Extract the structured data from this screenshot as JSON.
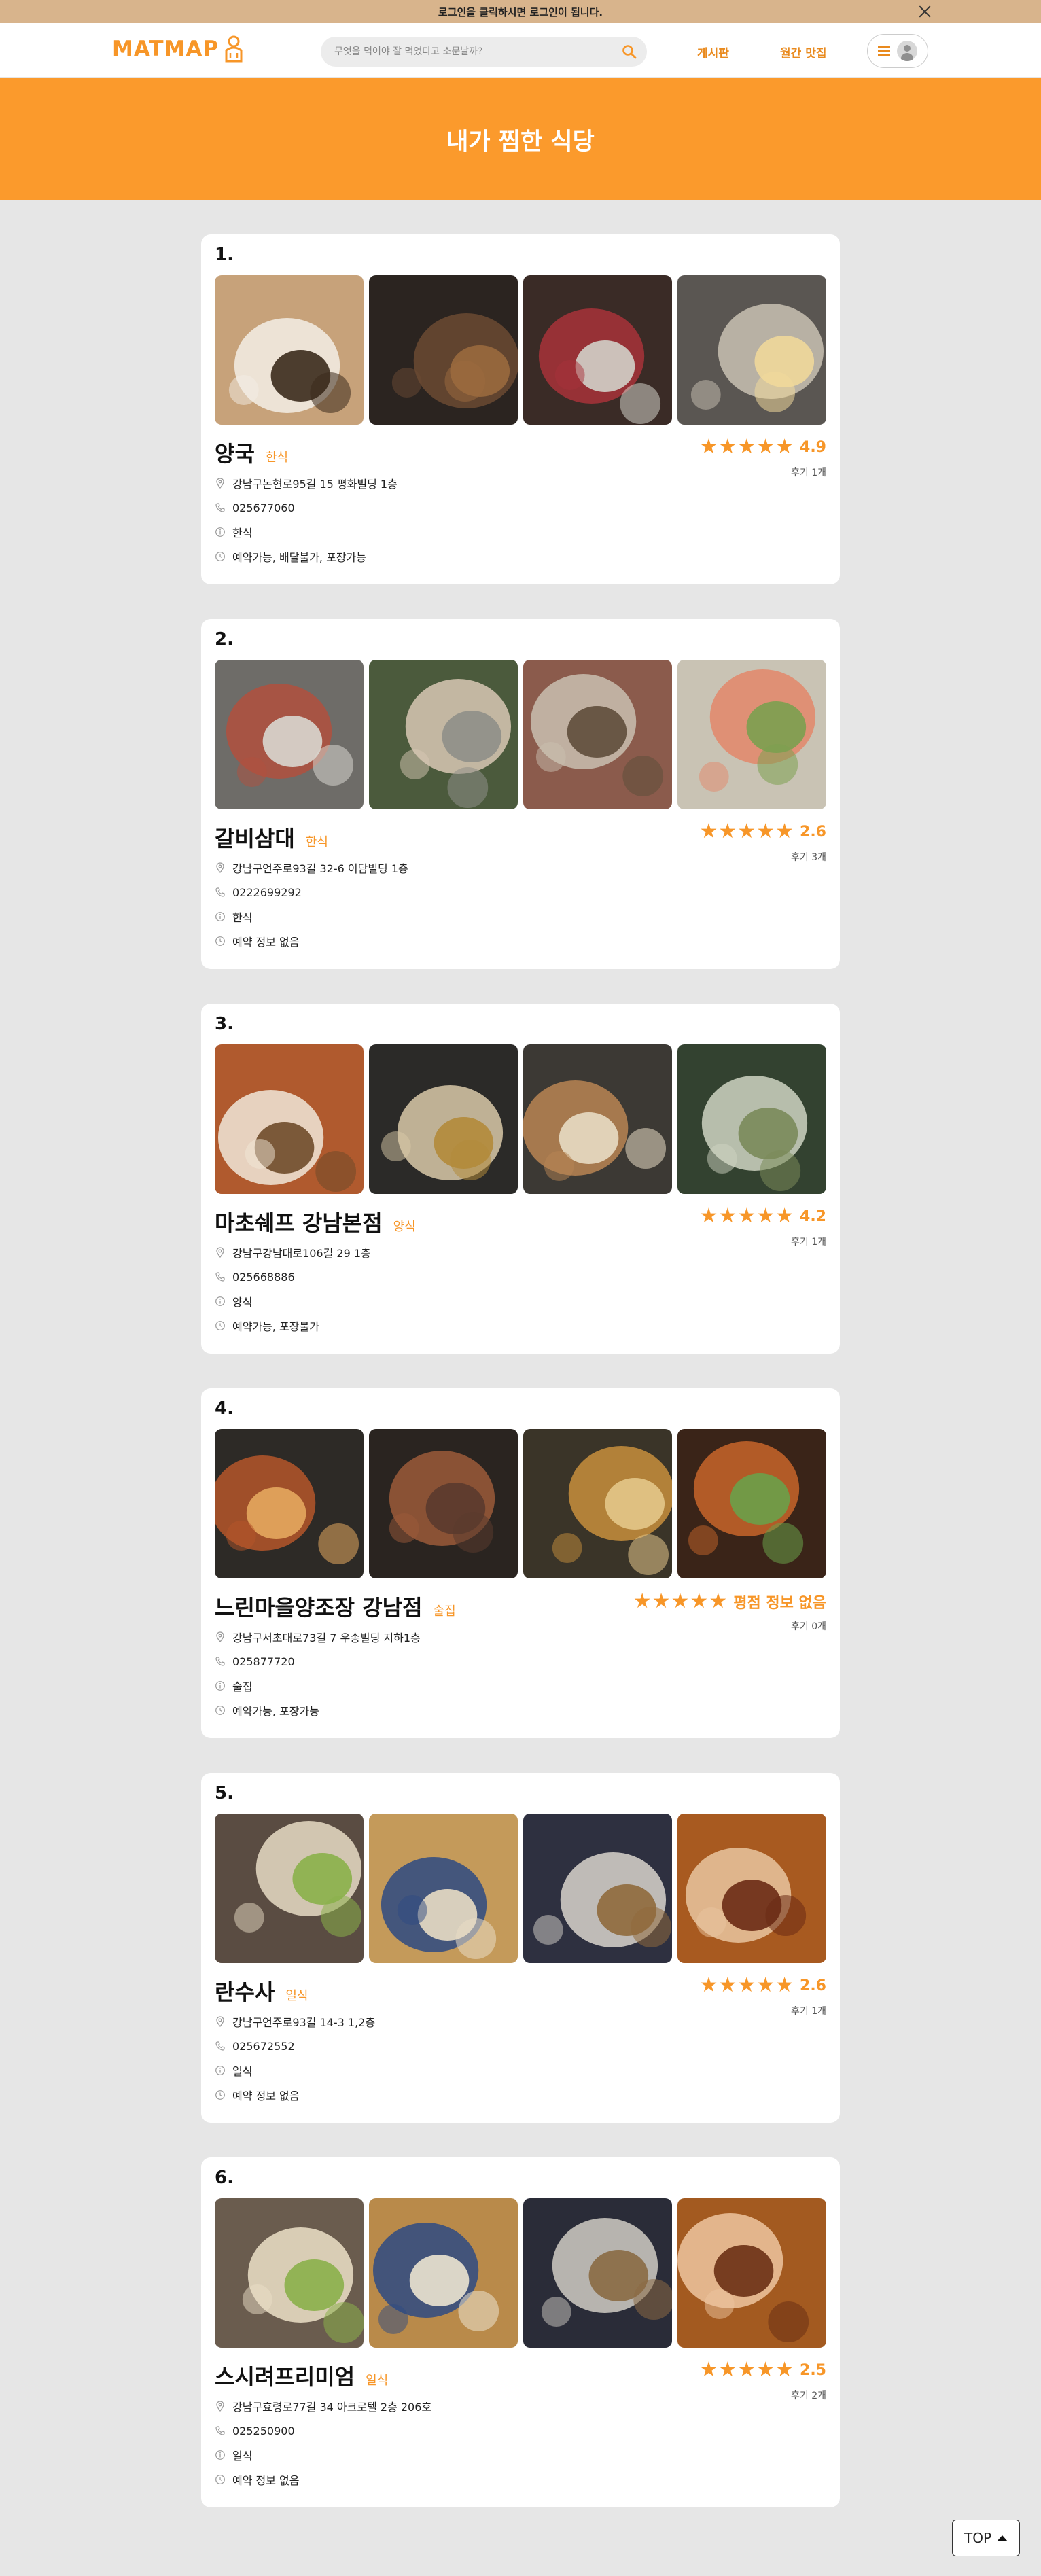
{
  "topbar": {
    "notice": "로그인을 클릭하시면 로그인이 됩니다."
  },
  "header": {
    "logo": "MATMAP",
    "search_placeholder": "무엇을 먹어야 잘 먹었다고 소문날까?",
    "nav_board": "게시판",
    "nav_monthly": "월간 맛집"
  },
  "banner": {
    "title": "내가 찜한 식당"
  },
  "restaurants": [
    {
      "num": "1.",
      "name": "양국",
      "category": "한식",
      "score": "4.9",
      "stars": 5,
      "reviews": "후기 1개",
      "address": "강남구논현로95길 15 평화빌딩 1층",
      "phone": "025677060",
      "food": "한식",
      "options": "예약가능, 배달불가, 포장가능"
    },
    {
      "num": "2.",
      "name": "갈비삼대",
      "category": "한식",
      "score": "2.6",
      "stars": 5,
      "reviews": "후기 3개",
      "address": "강남구언주로93길 32-6 이담빌딩 1층",
      "phone": "0222699292",
      "food": "한식",
      "options": "예약 정보 없음"
    },
    {
      "num": "3.",
      "name": "마초쉐프 강남본점",
      "category": "양식",
      "score": "4.2",
      "stars": 5,
      "reviews": "후기 1개",
      "address": "강남구강남대로106길 29 1층",
      "phone": "025668886",
      "food": "양식",
      "options": "예약가능, 포장불가"
    },
    {
      "num": "4.",
      "name": "느린마을양조장 강남점",
      "category": "술집",
      "score": "평점 정보 없음",
      "stars": 5,
      "reviews": "후기 0개",
      "address": "강남구서초대로73길 7 우송빌딩 지하1층",
      "phone": "025877720",
      "food": "술집",
      "options": "예약가능, 포장가능"
    },
    {
      "num": "5.",
      "name": "란수사",
      "category": "일식",
      "score": "2.6",
      "stars": 5,
      "reviews": "후기 1개",
      "address": "강남구언주로93길 14-3 1,2층",
      "phone": "025672552",
      "food": "일식",
      "options": "예약 정보 없음"
    },
    {
      "num": "6.",
      "name": "스시려프리미엄",
      "category": "일식",
      "score": "2.5",
      "stars": 5,
      "reviews": "후기 2개",
      "address": "강남구효령로77길 34 아크로텔 2층 206호",
      "phone": "025250900",
      "food": "일식",
      "options": "예약 정보 없음"
    }
  ],
  "top_button": "TOP",
  "colors": {
    "accent": "#f79628",
    "banner": "#fb9a2c",
    "topbar": "#d8b48c",
    "background": "#e6e6e6"
  }
}
